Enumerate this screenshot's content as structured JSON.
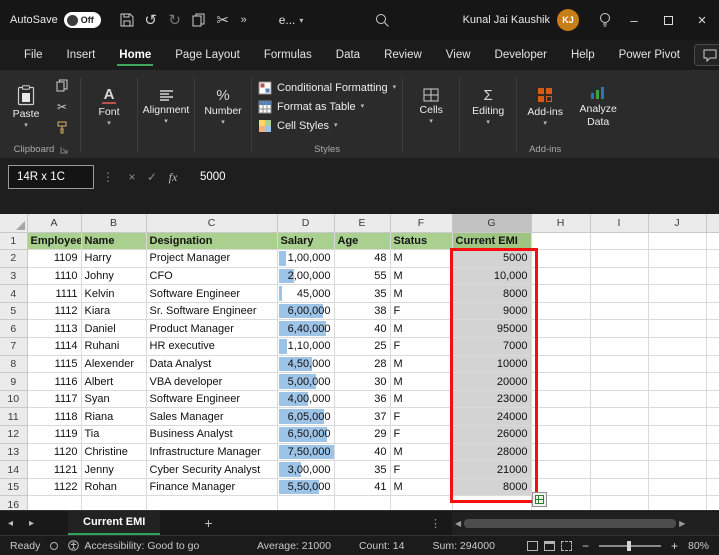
{
  "colors": {
    "accent_green": "#2ea35c",
    "header_green": "#A9D08E",
    "selection_gray": "#D3D3D3",
    "databar_blue": "#9DC3E6",
    "annotation_red": "#F50F0F",
    "avatar_orange": "#C87E16",
    "addins_orange": "#D55C19"
  },
  "titlebar": {
    "autosave_label": "AutoSave",
    "autosave_state": "Off",
    "workbook_menu": "e...",
    "user_name": "Kunal Jai Kaushik",
    "user_initials": "KJ"
  },
  "menubar": {
    "items": [
      {
        "label": "File",
        "active": false
      },
      {
        "label": "Insert",
        "active": false
      },
      {
        "label": "Home",
        "active": true
      },
      {
        "label": "Page Layout",
        "active": false
      },
      {
        "label": "Formulas",
        "active": false
      },
      {
        "label": "Data",
        "active": false
      },
      {
        "label": "Review",
        "active": false
      },
      {
        "label": "View",
        "active": false
      },
      {
        "label": "Developer",
        "active": false
      },
      {
        "label": "Help",
        "active": false
      },
      {
        "label": "Power Pivot",
        "active": false
      }
    ]
  },
  "ribbon": {
    "paste_label": "Paste",
    "clipboard_group_label": "Clipboard",
    "font_label": "Font",
    "alignment_label": "Alignment",
    "number_label": "Number",
    "conditional_formatting_label": "Conditional Formatting",
    "format_as_table_label": "Format as Table",
    "cell_styles_label": "Cell Styles",
    "styles_group_label": "Styles",
    "cells_label": "Cells",
    "editing_label": "Editing",
    "addins_label": "Add-ins",
    "addins_group_label": "Add-ins",
    "analyze_data_label": "Analyze Data"
  },
  "formula_bar": {
    "name_box": "14R x 1C",
    "fx_label": "fx",
    "value": "5000"
  },
  "sheet": {
    "column_letters": [
      "A",
      "B",
      "C",
      "D",
      "E",
      "F",
      "G",
      "H",
      "I",
      "J"
    ],
    "selected_column": "G",
    "selection_range_rows": "2-15",
    "header_row": {
      "employee": "Employee",
      "name": "Name",
      "designation": "Designation",
      "salary": "Salary",
      "age": "Age",
      "status": "Status",
      "emi": "Current EMI"
    },
    "rows": [
      {
        "employee": "1109",
        "name": "Harry",
        "designation": "Project Manager",
        "salary": "1,00,000",
        "age": "48",
        "status": "M",
        "emi": "5000"
      },
      {
        "employee": "1110",
        "name": "Johny",
        "designation": "CFO",
        "salary": "2,00,000",
        "age": "55",
        "status": "M",
        "emi": "10,000"
      },
      {
        "employee": "1111",
        "name": "Kelvin",
        "designation": "Software Engineer",
        "salary": "45,000",
        "age": "35",
        "status": "M",
        "emi": "8000"
      },
      {
        "employee": "1112",
        "name": "Kiara",
        "designation": "Sr. Software Engineer",
        "salary": "6,00,000",
        "age": "38",
        "status": "F",
        "emi": "9000"
      },
      {
        "employee": "1113",
        "name": "Daniel",
        "designation": "Product Manager",
        "salary": "6,40,000",
        "age": "40",
        "status": "M",
        "emi": "95000"
      },
      {
        "employee": "1114",
        "name": "Ruhani",
        "designation": "HR executive",
        "salary": "1,10,000",
        "age": "25",
        "status": "F",
        "emi": "7000"
      },
      {
        "employee": "1115",
        "name": "Alexender",
        "designation": "Data Analyst",
        "salary": "4,50,000",
        "age": "28",
        "status": "M",
        "emi": "10000"
      },
      {
        "employee": "1116",
        "name": "Albert",
        "designation": "VBA developer",
        "salary": "5,00,000",
        "age": "30",
        "status": "M",
        "emi": "20000"
      },
      {
        "employee": "1117",
        "name": "Syan",
        "designation": "Software Engineer",
        "salary": "4,00,000",
        "age": "36",
        "status": "M",
        "emi": "23000"
      },
      {
        "employee": "1118",
        "name": "Riana",
        "designation": "Sales Manager",
        "salary": "6,05,000",
        "age": "37",
        "status": "F",
        "emi": "24000"
      },
      {
        "employee": "1119",
        "name": "Tia",
        "designation": "Business Analyst",
        "salary": "6,50,000",
        "age": "29",
        "status": "F",
        "emi": "26000"
      },
      {
        "employee": "1120",
        "name": "Christine",
        "designation": "Infrastructure Manager",
        "salary": "7,50,000",
        "age": "40",
        "status": "M",
        "emi": "28000"
      },
      {
        "employee": "1121",
        "name": "Jenny",
        "designation": "Cyber Security Analyst",
        "salary": "3,00,000",
        "age": "35",
        "status": "F",
        "emi": "21000"
      },
      {
        "employee": "1122",
        "name": "Rohan",
        "designation": "Finance Manager",
        "salary": "5,50,000",
        "age": "41",
        "status": "M",
        "emi": "8000"
      }
    ],
    "total_visible_rows": 16,
    "salary_max_for_databar": 750000
  },
  "sheet_tabs": {
    "active_tab": "Current EMI"
  },
  "status_bar": {
    "mode": "Ready",
    "accessibility": "Accessibility: Good to go",
    "average": "Average: 21000",
    "count": "Count: 14",
    "sum": "Sum: 294000",
    "zoom_level": "80%"
  }
}
